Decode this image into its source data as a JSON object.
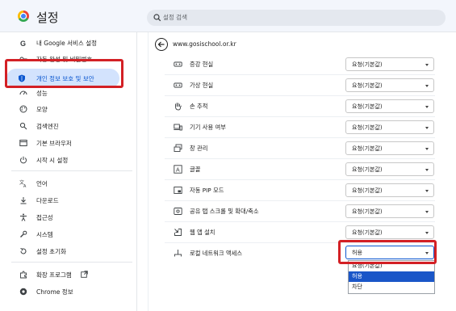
{
  "app": {
    "title": "설정",
    "icon": "chrome-logo-icon"
  },
  "search": {
    "placeholder": "설정 검색",
    "icon": "search-icon"
  },
  "sidebar": {
    "items": [
      {
        "label": "내 Google 서비스 설정",
        "icon": "google-g-icon"
      },
      {
        "label": "자동 완성 및 비밀번호",
        "icon": "key-icon"
      },
      {
        "label": "개인 정보 보호 및 보안",
        "icon": "shield-icon",
        "active": true
      },
      {
        "label": "성능",
        "icon": "speedometer-icon"
      },
      {
        "label": "모양",
        "icon": "palette-icon"
      },
      {
        "label": "검색엔진",
        "icon": "search-icon"
      },
      {
        "label": "기본 브라우저",
        "icon": "browser-window-icon"
      },
      {
        "label": "시작 시 설정",
        "icon": "power-icon"
      },
      {
        "label": "언어",
        "icon": "translate-icon"
      },
      {
        "label": "다운로드",
        "icon": "download-icon"
      },
      {
        "label": "접근성",
        "icon": "accessibility-icon"
      },
      {
        "label": "시스템",
        "icon": "wrench-icon"
      },
      {
        "label": "설정 초기화",
        "icon": "reset-icon"
      },
      {
        "label": "확장 프로그램",
        "icon": "puzzle-icon"
      },
      {
        "label": "Chrome 정보",
        "icon": "chrome-icon"
      }
    ],
    "extensions_external_icon": "external-link-icon"
  },
  "site": {
    "back_icon": "arrow-back-icon",
    "url": "www.gosischool.or.kr"
  },
  "permissions": [
    {
      "label": "증강 현실",
      "value": "요청(기본값)",
      "icon": "vr-headset-icon"
    },
    {
      "label": "가상 현실",
      "value": "요청(기본값)",
      "icon": "vr-headset-icon"
    },
    {
      "label": "손 추적",
      "value": "요청(기본값)",
      "icon": "hand-icon"
    },
    {
      "label": "기기 사용 여부",
      "value": "요청(기본값)",
      "icon": "devices-icon"
    },
    {
      "label": "창 관리",
      "value": "요청(기본값)",
      "icon": "windows-icon"
    },
    {
      "label": "글꼴",
      "value": "요청(기본값)",
      "icon": "font-icon"
    },
    {
      "label": "자동 PIP 모드",
      "value": "요청(기본값)",
      "icon": "pip-icon"
    },
    {
      "label": "공유 탭 스크롤 및 확대/축소",
      "value": "요청(기본값)",
      "icon": "screen-share-icon"
    },
    {
      "label": "웹 앱 설치",
      "value": "요청(기본값)",
      "icon": "install-icon"
    },
    {
      "label": "로컬 네트워크 액세스",
      "value": "허용",
      "icon": "network-icon"
    }
  ],
  "dropdown": {
    "options": [
      "요청(기본값)",
      "허용",
      "차단"
    ],
    "selected_index": 1
  },
  "colors": {
    "accent": "#0b57d0",
    "highlight_bg": "#d3e3fd",
    "annotation_red": "#d32025",
    "selection_blue": "#1a56c8"
  }
}
